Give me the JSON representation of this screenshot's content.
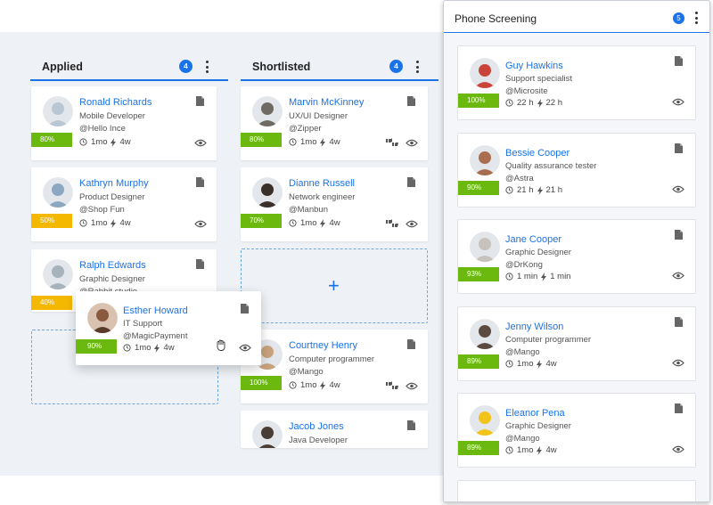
{
  "colors": {
    "accent": "#1a73e8",
    "green": "#6bb80f",
    "yellow": "#f5b800",
    "board_bg": "#eef2f6"
  },
  "columns": [
    {
      "title": "Applied",
      "count": "4",
      "cards": [
        {
          "name": "Ronald Richards",
          "role": "Mobile Developer",
          "company": "@Hello Ince",
          "time": "1mo",
          "duration": "4w",
          "pct": "80%",
          "pct_color": "green",
          "avatar_color": "#b9c7d4"
        },
        {
          "name": "Kathryn Murphy",
          "role": "Product Designer",
          "company": "@Shop Fun",
          "time": "1mo",
          "duration": "4w",
          "pct": "50%",
          "pct_color": "yellow",
          "avatar_color": "#8ba7c2"
        },
        {
          "name": "Ralph Edwards",
          "role": "Graphic Designer",
          "company": "@Rabbit studio",
          "time": "",
          "duration": "",
          "pct": "40%",
          "pct_color": "yellow",
          "avatar_color": "#a6b3bd"
        }
      ]
    },
    {
      "title": "Shortlisted",
      "count": "4",
      "cards": [
        {
          "name": "Marvin McKinney",
          "role": "UX/UI Designer",
          "company": "@Zipper",
          "time": "1mo",
          "duration": "4w",
          "pct": "80%",
          "pct_color": "green",
          "avatar_color": "#6f6a63"
        },
        {
          "name": "Dianne Russell",
          "role": "Network engineer",
          "company": "@Manbun",
          "time": "1mo",
          "duration": "4w",
          "pct": "70%",
          "pct_color": "green",
          "avatar_color": "#3b2f2a"
        },
        {
          "name": "Courtney Henry",
          "role": "Computer programmer",
          "company": "@Mango",
          "time": "1mo",
          "duration": "4w",
          "pct": "100%",
          "pct_color": "green",
          "avatar_color": "#c9a27d"
        },
        {
          "name": "Jacob Jones",
          "role": "Java Developer",
          "company": "",
          "time": "",
          "duration": "",
          "pct": "",
          "pct_color": "green",
          "avatar_color": "#4a3d36"
        }
      ]
    }
  ],
  "dragging_card": {
    "name": "Esther Howard",
    "role": "IT Support",
    "company": "@MagicPayment",
    "time": "1mo",
    "duration": "4w",
    "pct": "90%",
    "pct_color": "green",
    "avatar_color": "#8a5a3f"
  },
  "panel": {
    "title": "Phone Screening",
    "count": "5",
    "cards": [
      {
        "name": "Guy Hawkins",
        "role": "Support specialist",
        "company": "@Microsite",
        "time": "22 h",
        "duration": "22 h",
        "pct": "100%",
        "pct_color": "green",
        "avatar_color": "#c9453b"
      },
      {
        "name": "Bessie Cooper",
        "role": "Quality assurance tester",
        "company": "@Astra",
        "time": "21 h",
        "duration": "21 h",
        "pct": "90%",
        "pct_color": "green",
        "avatar_color": "#a86e4f"
      },
      {
        "name": "Jane Cooper",
        "role": "Graphic Designer",
        "company": "@DrKong",
        "time": "1 min",
        "duration": "1 min",
        "pct": "93%",
        "pct_color": "green",
        "avatar_color": "#c8c2bc"
      },
      {
        "name": "Jenny Wilson",
        "role": "Computer programmer",
        "company": "@Mango",
        "time": "1mo",
        "duration": "4w",
        "pct": "89%",
        "pct_color": "green",
        "avatar_color": "#5b4a3f"
      },
      {
        "name": "Eleanor Pena",
        "role": "Graphic Designer",
        "company": "@Mango",
        "time": "1mo",
        "duration": "4w",
        "pct": "89%",
        "pct_color": "green",
        "avatar_color": "#f2c318"
      }
    ]
  },
  "icons": {
    "document": "document-icon",
    "eye": "eye-icon",
    "clock": "clock-icon",
    "bolt": "bolt-icon",
    "thumbs": "thumbs-up-down-icon",
    "plus": "plus-icon",
    "grab": "grab-hand-icon"
  },
  "plus_symbol": "+"
}
